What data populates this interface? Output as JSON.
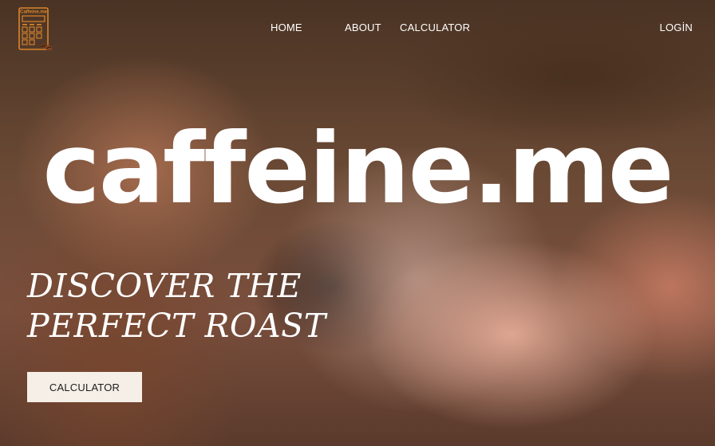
{
  "brand": {
    "logo_text": "Caffeine.me"
  },
  "nav": {
    "home": "HOME",
    "about": "ABOUT",
    "calculator": "CALCULATOR",
    "login": "LOGİN"
  },
  "hero": {
    "title": "caffeine.me",
    "tagline_line1": "DISCOVER THE",
    "tagline_line2": "PERFECT ROAST",
    "cta_label": "CALCULATOR"
  },
  "colors": {
    "logo_accent": "#d9862c",
    "text": "#ffffff",
    "button_bg": "#f6efe8"
  },
  "icons": {
    "logo": "calculator-with-coffee-beans-icon"
  }
}
